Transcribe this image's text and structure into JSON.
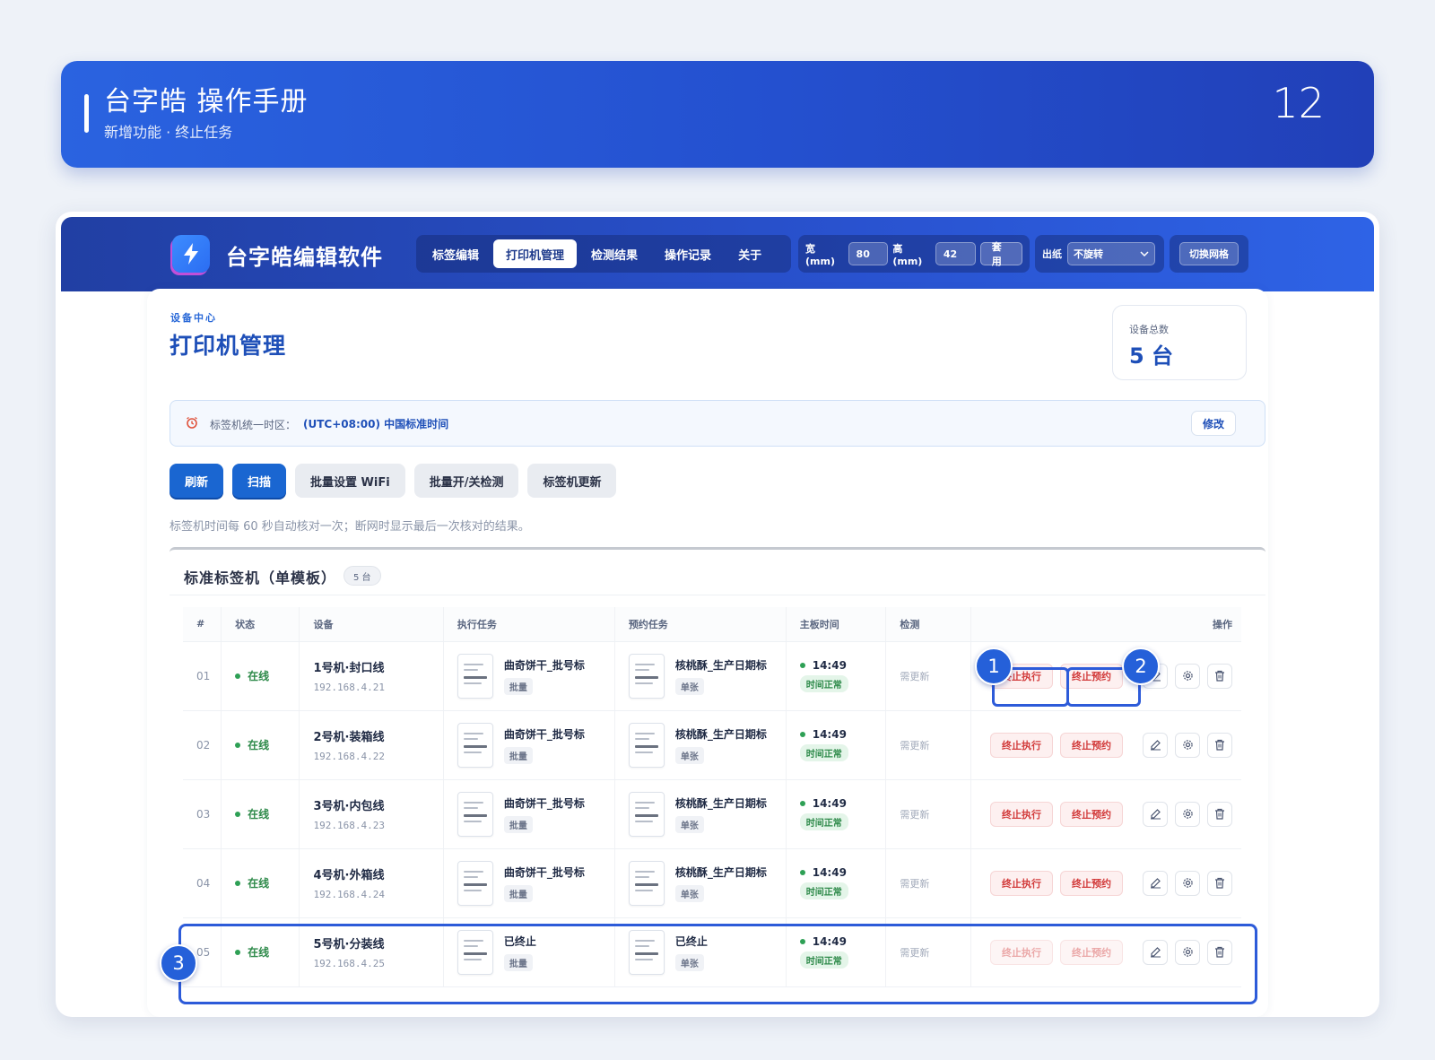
{
  "banner": {
    "title": "台字皓 操作手册",
    "subtitle": "新增功能 · 终止任务",
    "page_number": "12"
  },
  "app": {
    "name": "台字皓编辑软件",
    "tabs": [
      "标签编辑",
      "打印机管理",
      "检测结果",
      "操作记录",
      "关于"
    ],
    "active_tab": "打印机管理",
    "width_label": "宽(mm)",
    "width_value": "80",
    "height_label": "高(mm)",
    "height_value": "42",
    "apply_label": "套用",
    "paper_label": "出纸",
    "paper_value": "不旋转",
    "grid_toggle_label": "切换网格"
  },
  "page": {
    "eyebrow": "设备中心",
    "title": "打印机管理",
    "device_total_label": "设备总数",
    "device_total_value": "5 台"
  },
  "timezone": {
    "label": "标签机统一时区：",
    "value": "(UTC+08:00) 中国标准时间",
    "edit_label": "修改"
  },
  "actions": {
    "refresh": "刷新",
    "scan": "扫描",
    "wifi": "批量设置 WiFi",
    "detect_toggle": "批量开/关检测",
    "update": "标签机更新"
  },
  "hint": "标签机时间每 60 秒自动核对一次；断网时显示最后一次核对的结果。",
  "section": {
    "title": "标准标签机（单模板）",
    "count_badge": "5 台"
  },
  "table": {
    "headers": {
      "index": "#",
      "status": "状态",
      "device": "设备",
      "exec_task": "执行任务",
      "reserved_task": "预约任务",
      "board_time": "主板时间",
      "detect": "检测",
      "ops": "操作"
    },
    "rows": [
      {
        "index": "01",
        "status": "在线",
        "name": "1号机·封口线",
        "ip": "192.168.4.21",
        "exec_task": "曲奇饼干_批号标",
        "exec_tag": "批量",
        "res_task": "核桃酥_生产日期标",
        "res_tag": "单张",
        "time": "14:49",
        "time_status": "时间正常",
        "detect": "需更新",
        "stop_exec": "终止执行",
        "stop_res": "终止预约"
      },
      {
        "index": "02",
        "status": "在线",
        "name": "2号机·装箱线",
        "ip": "192.168.4.22",
        "exec_task": "曲奇饼干_批号标",
        "exec_tag": "批量",
        "res_task": "核桃酥_生产日期标",
        "res_tag": "单张",
        "time": "14:49",
        "time_status": "时间正常",
        "detect": "需更新",
        "stop_exec": "终止执行",
        "stop_res": "终止预约"
      },
      {
        "index": "03",
        "status": "在线",
        "name": "3号机·内包线",
        "ip": "192.168.4.23",
        "exec_task": "曲奇饼干_批号标",
        "exec_tag": "批量",
        "res_task": "核桃酥_生产日期标",
        "res_tag": "单张",
        "time": "14:49",
        "time_status": "时间正常",
        "detect": "需更新",
        "stop_exec": "终止执行",
        "stop_res": "终止预约"
      },
      {
        "index": "04",
        "status": "在线",
        "name": "4号机·外箱线",
        "ip": "192.168.4.24",
        "exec_task": "曲奇饼干_批号标",
        "exec_tag": "批量",
        "res_task": "核桃酥_生产日期标",
        "res_tag": "单张",
        "time": "14:49",
        "time_status": "时间正常",
        "detect": "需更新",
        "stop_exec": "终止执行",
        "stop_res": "终止预约"
      },
      {
        "index": "05",
        "status": "在线",
        "name": "5号机·分装线",
        "ip": "192.168.4.25",
        "exec_task": "已终止",
        "exec_tag": "批量",
        "res_task": "已终止",
        "res_tag": "单张",
        "time": "14:49",
        "time_status": "时间正常",
        "detect": "需更新",
        "stop_exec": "终止执行",
        "stop_res": "终止预约"
      }
    ]
  },
  "callouts": [
    "1",
    "2",
    "3"
  ],
  "colors": {
    "brand": "#2450cf",
    "accent": "#1a66d1",
    "danger": "#d23b3b",
    "success": "#2e8a4a"
  }
}
